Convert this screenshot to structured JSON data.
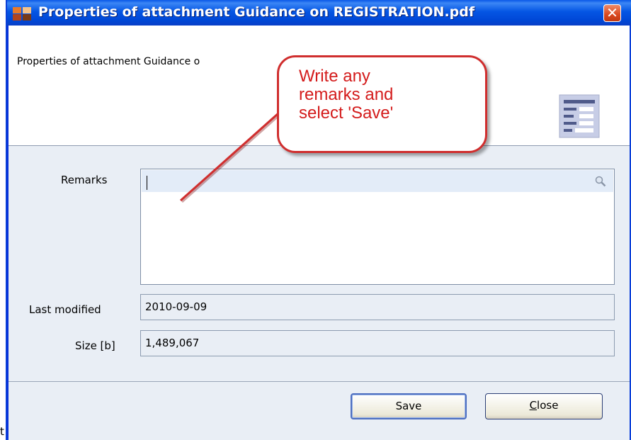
{
  "window": {
    "title": "Properties of attachment Guidance on REGISTRATION.pdf",
    "close_glyph": "✕"
  },
  "header": {
    "text": "Properties of attachment Guidance o"
  },
  "form": {
    "remarks_label": "Remarks",
    "remarks_value": "",
    "last_modified_label": "Last modified",
    "last_modified_value": "2010-09-09",
    "size_label": "Size [b]",
    "size_value": "1,489,067"
  },
  "buttons": {
    "save_label": "Save",
    "close_label_rest": "lose",
    "close_label_mnemonic": "C"
  },
  "callout": {
    "line1": "Write any",
    "line2": "remarks and",
    "line3": "select 'Save'"
  },
  "edge_text": "t",
  "colors": {
    "titlebar": "#0556e4",
    "callout_border": "#d02e2e",
    "callout_text": "#d41c1c",
    "field_bg": "#e9eef5"
  },
  "icons": [
    "app-icon",
    "close-icon",
    "document-properties-icon",
    "search-icon"
  ]
}
